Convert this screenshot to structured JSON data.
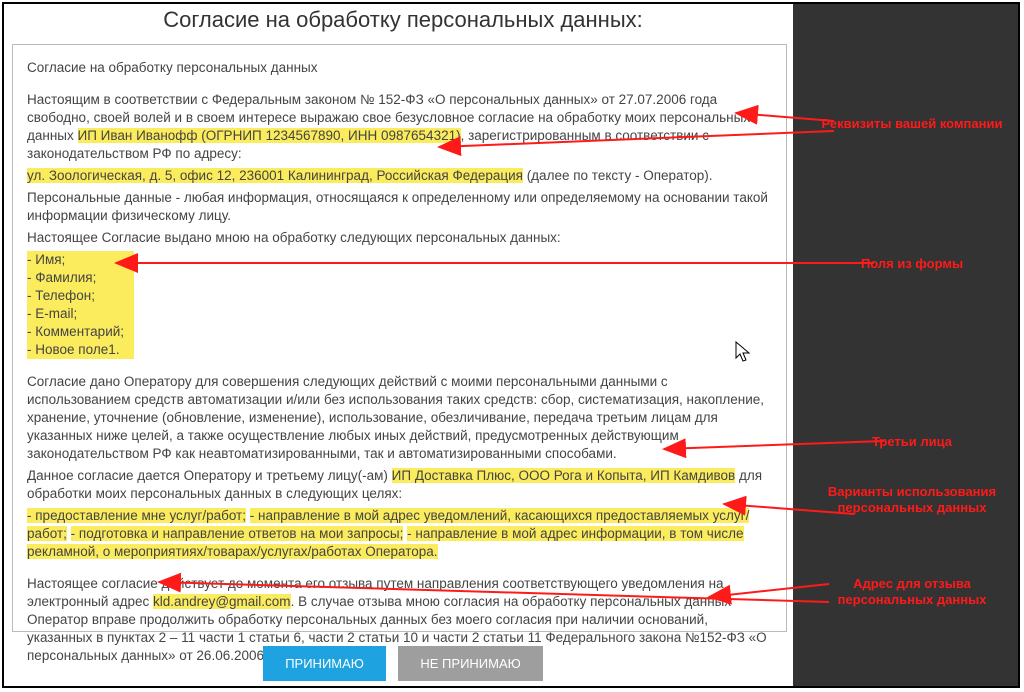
{
  "dialog": {
    "title": "Согласие на обработку персональных данных:",
    "heading": "Согласие на обработку персональных данных",
    "intro_1": "Настоящим в соответствии с Федеральным законом № 152-ФЗ «О персональных данных» от 27.07.2006 года свободно, своей волей и в своем интересе выражаю свое безусловное согласие на обработку моих персональных данных ",
    "company_name": "ИП Иван Иванофф (ОГРНИП 1234567890, ИНН 0987654321)",
    "intro_2": ", зарегистрированным в соответствии с законодательством РФ по адресу:",
    "company_addr": "ул. Зоологическая, д. 5, офис 12, 236001 Калининград, Российская Федерация",
    "intro_3": " (далее по тексту - Оператор).",
    "definition": "Персональные данные - любая информация, относящаяся к определенному или определяемому на основании такой информации физическому лицу.",
    "fields_lead": "Настоящее Согласие выдано мною на обработку следующих персональных данных:",
    "fields": [
      "- Имя;",
      "- Фамилия;",
      "- Телефон;",
      "- E-mail;",
      "- Комментарий;",
      "- Новое поле1."
    ],
    "actions": "Согласие дано Оператору для совершения следующих действий с моими персональными данными с использованием средств автоматизации и/или без использования таких средств: сбор, систематизация, накопление, хранение, уточнение (обновление, изменение), использование, обезличивание, передача третьим лицам для указанных ниже целей, а также осуществление любых иных действий, предусмотренных действующим законодательством РФ как неавтоматизированными, так и автоматизированными способами.",
    "third_lead": "Данное согласие дается Оператору и третьему лицу(-ам) ",
    "third_parties": "ИП Доставка Плюс, ООО Рога и Копыта, ИП Камдивов",
    "third_tail": " для обработки моих персональных данных в следующих целях:",
    "usages": [
      "- предоставление мне услуг/работ;",
      "- направление в мой адрес уведомлений, касающихся предоставляемых услуг/работ;",
      "- подготовка и направление ответов на мои запросы;",
      "- направление в мой адрес информации, в том числе рекламной, о мероприятиях/товарах/услугах/работах Оператора."
    ],
    "revoke_1": "Настоящее согласие действует до момента его отзыва путем направления соответствующего уведомления на электронный адрес ",
    "revoke_email": "kld.andrey@gmail.com",
    "revoke_2": ". В случае отзыва мною согласия на обработку персональных данных Оператор вправе продолжить обработку персональных данных без моего согласия при наличии оснований, указанных в пунктах 2 – 11 части 1 статьи 6, части 2 статьи 10 и части 2 статьи 11 Федерального закона №152-ФЗ «О персональных данных» от 26.06.2006 г.",
    "accept": "ПРИНИМАЮ",
    "decline": "НЕ ПРИНИМАЮ"
  },
  "callouts": {
    "company": "Реквизиты вашей компании",
    "fields": "Поля из формы",
    "third": "Третьи лица",
    "usage": "Варианты использования персональных данных",
    "email": "Адрес для отзыва персональных данных"
  }
}
